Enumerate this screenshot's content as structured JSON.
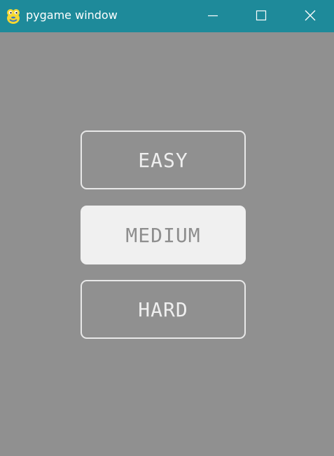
{
  "window": {
    "title": "pygame window",
    "controls": {
      "minimize": "minimize-icon",
      "maximize": "maximize-icon",
      "close": "close-icon"
    },
    "titlebar_color": "#1e8a9a",
    "background_color": "#909090"
  },
  "menu": {
    "buttons": [
      {
        "label": "EASY",
        "state": "normal"
      },
      {
        "label": "MEDIUM",
        "state": "highlighted"
      },
      {
        "label": "HARD",
        "state": "normal"
      }
    ],
    "highlight_color": "#f0f0f0"
  }
}
